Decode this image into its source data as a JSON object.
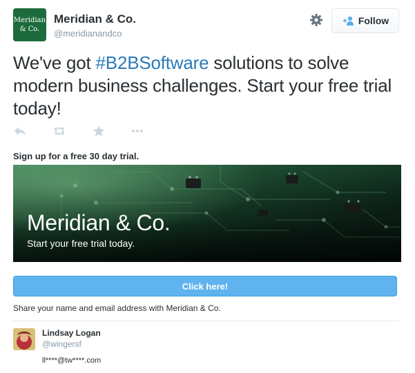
{
  "account": {
    "logo_line1": "Meridian",
    "logo_line2": "& Co.",
    "name": "Meridian & Co.",
    "handle": "@meridianandco",
    "follow_label": "Follow",
    "follow_icon": "person-plus-icon",
    "settings_icon": "gear-icon"
  },
  "tweet": {
    "text_before": "We've got ",
    "hashtag": "#B2BSoftware",
    "text_after": " solutions to solve modern business challenges. Start your free trial today!",
    "actions": [
      "reply-icon",
      "retweet-icon",
      "favorite-icon",
      "more-icon"
    ]
  },
  "card": {
    "title": "Sign up for a free 30 day trial.",
    "banner_title": "Meridian & Co.",
    "banner_subtitle": "Start your free trial today.",
    "cta_label": "Click here!",
    "share_note": "Share your name and email address with Meridian & Co."
  },
  "user": {
    "name": "Lindsay Logan",
    "handle": "@wingersf",
    "email": "ll****@tw****.com"
  },
  "colors": {
    "brand_green": "#1d6b3c",
    "link_blue": "#2b7bb9",
    "cta_blue": "#5fb3ee",
    "muted_gray": "#8899a6",
    "text": "#292f33"
  }
}
